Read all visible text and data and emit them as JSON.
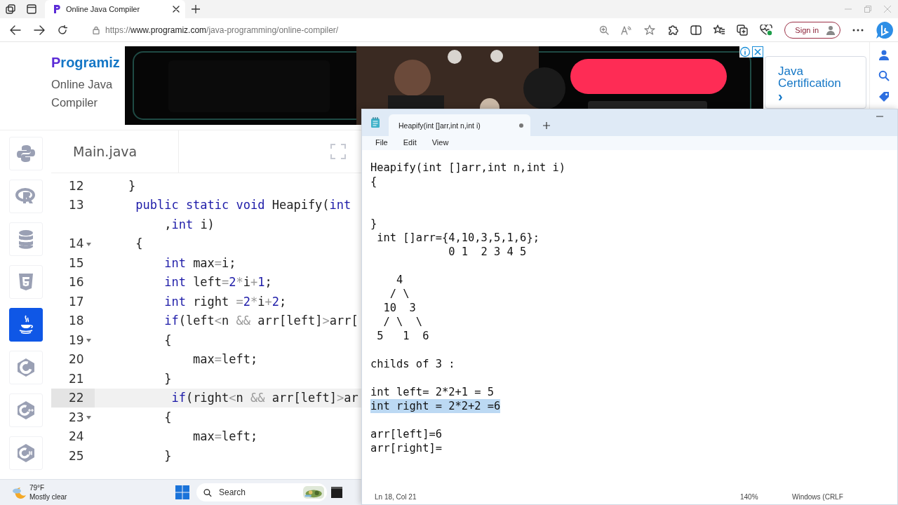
{
  "browser": {
    "tabs": [
      {
        "title": "Online Java Compiler",
        "selected": true
      }
    ],
    "address": {
      "scheme": "https://",
      "domain": "www.programiz.com",
      "path": "/java-programming/online-compiler/"
    },
    "sign_in": "Sign in"
  },
  "site": {
    "logo": "Programiz",
    "subtitle": "Online Java Compiler",
    "promo": {
      "title": "Java Certification",
      "arrow": "›"
    }
  },
  "languages": [
    {
      "kind": "python",
      "selected": false
    },
    {
      "kind": "r",
      "selected": false
    },
    {
      "kind": "sql",
      "selected": false
    },
    {
      "kind": "html",
      "selected": false
    },
    {
      "kind": "java",
      "selected": true
    },
    {
      "kind": "c",
      "selected": false
    },
    {
      "kind": "cpp",
      "selected": false
    },
    {
      "kind": "csharp",
      "selected": false
    }
  ],
  "editor": {
    "file": "Main.java",
    "lines": [
      {
        "kind": "line",
        "number": "12",
        "fold": false,
        "selected": false,
        "tokens": [
          {
            "kind": "plain",
            "text": "}"
          }
        ]
      },
      {
        "kind": "line",
        "number": "13",
        "fold": false,
        "selected": false,
        "tokens": [
          {
            "kind": "keyword",
            "text": " public static void"
          },
          {
            "kind": "plain",
            "text": " Heapify("
          },
          {
            "kind": "keyword",
            "text": "int"
          }
        ]
      },
      {
        "kind": "wrap",
        "tokens": [
          {
            "kind": "plain",
            "text": "     ,"
          },
          {
            "kind": "keyword",
            "text": "int"
          },
          {
            "kind": "plain",
            "text": " i)"
          }
        ]
      },
      {
        "kind": "line",
        "number": "14",
        "fold": true,
        "selected": false,
        "tokens": [
          {
            "kind": "plain",
            "text": " {"
          }
        ]
      },
      {
        "kind": "line",
        "number": "15",
        "fold": false,
        "selected": false,
        "tokens": [
          {
            "kind": "keyword",
            "text": "     int"
          },
          {
            "kind": "plain",
            "text": " max"
          },
          {
            "kind": "operator",
            "text": "="
          },
          {
            "kind": "plain",
            "text": "i;"
          }
        ]
      },
      {
        "kind": "line",
        "number": "16",
        "fold": false,
        "selected": false,
        "tokens": [
          {
            "kind": "keyword",
            "text": "     int"
          },
          {
            "kind": "plain",
            "text": " left"
          },
          {
            "kind": "operator",
            "text": "="
          },
          {
            "kind": "number",
            "text": "2"
          },
          {
            "kind": "operator",
            "text": "*"
          },
          {
            "kind": "plain",
            "text": "i"
          },
          {
            "kind": "operator",
            "text": "+"
          },
          {
            "kind": "number",
            "text": "1"
          },
          {
            "kind": "plain",
            "text": ";"
          }
        ]
      },
      {
        "kind": "line",
        "number": "17",
        "fold": false,
        "selected": false,
        "tokens": [
          {
            "kind": "keyword",
            "text": "     int"
          },
          {
            "kind": "plain",
            "text": " right "
          },
          {
            "kind": "operator",
            "text": "="
          },
          {
            "kind": "number",
            "text": "2"
          },
          {
            "kind": "operator",
            "text": "*"
          },
          {
            "kind": "plain",
            "text": "i"
          },
          {
            "kind": "operator",
            "text": "+"
          },
          {
            "kind": "number",
            "text": "2"
          },
          {
            "kind": "plain",
            "text": ";"
          }
        ]
      },
      {
        "kind": "line",
        "number": "18",
        "fold": false,
        "selected": false,
        "tokens": [
          {
            "kind": "keyword",
            "text": "     if"
          },
          {
            "kind": "plain",
            "text": "(left"
          },
          {
            "kind": "operator",
            "text": "<"
          },
          {
            "kind": "plain",
            "text": "n "
          },
          {
            "kind": "operator",
            "text": "&&"
          },
          {
            "kind": "plain",
            "text": " arr[left]"
          },
          {
            "kind": "operator",
            "text": ">"
          },
          {
            "kind": "plain",
            "text": "arr["
          }
        ]
      },
      {
        "kind": "line",
        "number": "19",
        "fold": true,
        "selected": false,
        "tokens": [
          {
            "kind": "plain",
            "text": "     {"
          }
        ]
      },
      {
        "kind": "line",
        "number": "20",
        "fold": false,
        "selected": false,
        "tokens": [
          {
            "kind": "plain",
            "text": "         max"
          },
          {
            "kind": "operator",
            "text": "="
          },
          {
            "kind": "plain",
            "text": "left;"
          }
        ]
      },
      {
        "kind": "line",
        "number": "21",
        "fold": false,
        "selected": false,
        "tokens": [
          {
            "kind": "plain",
            "text": "     }"
          }
        ]
      },
      {
        "kind": "line",
        "number": "22",
        "fold": false,
        "selected": true,
        "tokens": [
          {
            "kind": "keyword",
            "text": "      if"
          },
          {
            "kind": "plain",
            "text": "(right"
          },
          {
            "kind": "operator",
            "text": "<"
          },
          {
            "kind": "plain",
            "text": "n "
          },
          {
            "kind": "operator",
            "text": "&&"
          },
          {
            "kind": "plain",
            "text": " arr[left]"
          },
          {
            "kind": "operator",
            "text": ">"
          },
          {
            "kind": "plain",
            "text": "ar"
          }
        ]
      },
      {
        "kind": "line",
        "number": "23",
        "fold": true,
        "selected": false,
        "tokens": [
          {
            "kind": "plain",
            "text": "     {"
          }
        ]
      },
      {
        "kind": "line",
        "number": "24",
        "fold": false,
        "selected": false,
        "tokens": [
          {
            "kind": "plain",
            "text": "         max"
          },
          {
            "kind": "operator",
            "text": "="
          },
          {
            "kind": "plain",
            "text": "left;"
          }
        ]
      },
      {
        "kind": "line",
        "number": "25",
        "fold": false,
        "selected": false,
        "tokens": [
          {
            "kind": "plain",
            "text": "     }"
          }
        ]
      }
    ]
  },
  "notepad": {
    "tab_title": "Heapify(int []arr,int n,int i)",
    "modified": true,
    "menu": [
      "File",
      "Edit",
      "View"
    ],
    "lines": [
      {
        "kind": "text",
        "text": "Heapify(int []arr,int n,int i)",
        "selected": false
      },
      {
        "kind": "text",
        "text": "{",
        "selected": false
      },
      {
        "kind": "blank"
      },
      {
        "kind": "blank"
      },
      {
        "kind": "text",
        "text": "}",
        "selected": false
      },
      {
        "kind": "text",
        "text": " int []arr={4,10,3,5,1,6};",
        "selected": false
      },
      {
        "kind": "text",
        "text": "            0 1  2 3 4 5",
        "selected": false
      },
      {
        "kind": "blank"
      },
      {
        "kind": "text",
        "text": "    4",
        "selected": false
      },
      {
        "kind": "text",
        "text": "   / \\",
        "selected": false
      },
      {
        "kind": "text",
        "text": "  10  3",
        "selected": false
      },
      {
        "kind": "text",
        "text": "  / \\  \\",
        "selected": false
      },
      {
        "kind": "text",
        "text": " 5   1  6",
        "selected": false
      },
      {
        "kind": "blank"
      },
      {
        "kind": "text",
        "text": "childs of 3 :",
        "selected": false
      },
      {
        "kind": "blank"
      },
      {
        "kind": "text",
        "text": "int left= 2*2+1 = 5",
        "selected": false
      },
      {
        "kind": "text",
        "text": "int right = 2*2+2 =6",
        "selected": true
      },
      {
        "kind": "blank"
      },
      {
        "kind": "text",
        "text": "arr[left]=6",
        "selected": false
      },
      {
        "kind": "text",
        "text": "arr[right]=",
        "selected": false
      }
    ],
    "status": {
      "position": "Ln 18, Col 21",
      "zoom": "140%",
      "line_ending": "Windows (CRLF"
    }
  },
  "taskbar": {
    "temperature": "79°F",
    "weather": "Mostly clear",
    "search": {
      "placeholder": "Search"
    }
  }
}
